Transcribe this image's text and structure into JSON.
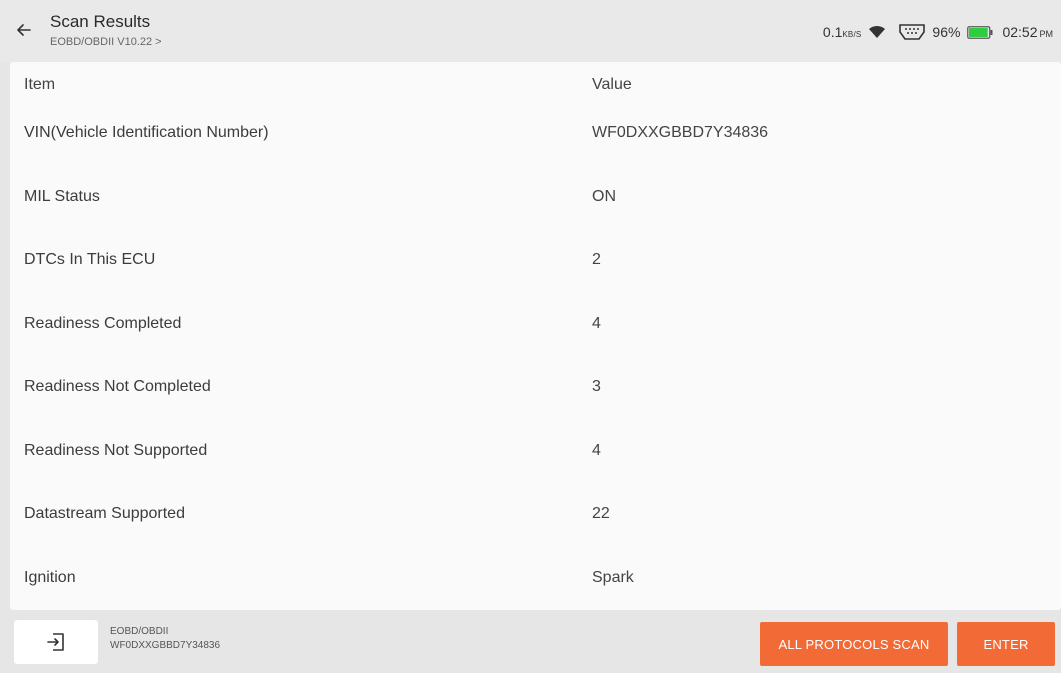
{
  "header": {
    "title": "Scan Results",
    "breadcrumb": "EOBD/OBDII V10.22 >"
  },
  "status_bar": {
    "net_speed_value": "0.1",
    "net_speed_unit": "KB/S",
    "battery_percent": "96%",
    "time": "02:52",
    "ampm": "PM",
    "battery_level": 0.96,
    "battery_color": "#2ecc40"
  },
  "table": {
    "headers": {
      "item": "Item",
      "value": "Value"
    },
    "rows": [
      {
        "item": "VIN(Vehicle Identification Number)",
        "value": "WF0DXXGBBD7Y34836"
      },
      {
        "item": "MIL Status",
        "value": "ON"
      },
      {
        "item": "DTCs In This ECU",
        "value": "2"
      },
      {
        "item": "Readiness Completed",
        "value": "4"
      },
      {
        "item": "Readiness Not Completed",
        "value": "3"
      },
      {
        "item": "Readiness Not Supported",
        "value": "4"
      },
      {
        "item": "Datastream Supported",
        "value": "22"
      },
      {
        "item": "Ignition",
        "value": "Spark"
      }
    ]
  },
  "bottom_bar": {
    "system": "EOBD/OBDII",
    "vin": "WF0DXXGBBD7Y34836",
    "all_protocols_label": "ALL PROTOCOLS SCAN",
    "enter_label": "ENTER",
    "accent_color": "#f26a36"
  },
  "icons": {
    "back": "arrow-left-icon",
    "wifi": "wifi-icon",
    "vci": "vci-connector-icon",
    "battery": "battery-icon",
    "exit": "exit-icon"
  }
}
